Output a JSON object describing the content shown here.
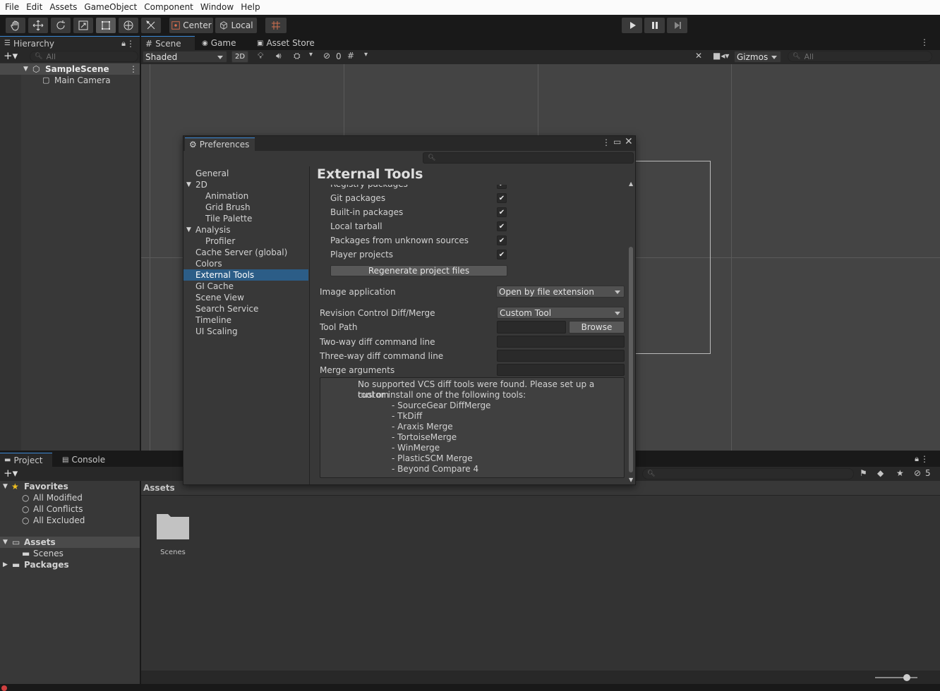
{
  "menubar": {
    "items": [
      "File",
      "Edit",
      "Assets",
      "GameObject",
      "Component",
      "Window",
      "Help"
    ]
  },
  "toolbar": {
    "tools": [
      "hand-icon",
      "move-icon",
      "rotate-icon",
      "scale-icon",
      "rect-icon",
      "transform-icon",
      "custom-tool-icon"
    ],
    "pivot_label": "Center",
    "space_label": "Local",
    "play_controls": [
      "play-icon",
      "pause-icon",
      "step-icon"
    ]
  },
  "hierarchy": {
    "tab_label": "Hierarchy",
    "search_placeholder": "All",
    "scene_name": "SampleScene",
    "objects": [
      "Main Camera"
    ]
  },
  "scene_view": {
    "tabs": [
      "Scene",
      "Game",
      "Asset Store"
    ],
    "shading_mode": "Shaded",
    "mode_2d_label": "2D",
    "hidden_count": "0",
    "gizmos_label": "Gizmos",
    "search_placeholder": "All"
  },
  "preferences": {
    "window_title": "Preferences",
    "sidebar": {
      "items": [
        {
          "label": "General",
          "indent": 0
        },
        {
          "label": "2D",
          "indent": 0,
          "foldout": true
        },
        {
          "label": "Animation",
          "indent": 1
        },
        {
          "label": "Grid Brush",
          "indent": 1
        },
        {
          "label": "Tile Palette",
          "indent": 1
        },
        {
          "label": "Analysis",
          "indent": 0,
          "foldout": true
        },
        {
          "label": "Profiler",
          "indent": 1
        },
        {
          "label": "Cache Server (global)",
          "indent": 0
        },
        {
          "label": "Colors",
          "indent": 0
        },
        {
          "label": "External Tools",
          "indent": 0,
          "selected": true
        },
        {
          "label": "GI Cache",
          "indent": 0
        },
        {
          "label": "Scene View",
          "indent": 0
        },
        {
          "label": "Search Service",
          "indent": 0
        },
        {
          "label": "Timeline",
          "indent": 0
        },
        {
          "label": "UI Scaling",
          "indent": 0
        }
      ]
    },
    "content": {
      "heading": "External Tools",
      "package_options": [
        {
          "label": "Registry packages",
          "checked": true
        },
        {
          "label": "Git packages",
          "checked": true
        },
        {
          "label": "Built-in packages",
          "checked": true
        },
        {
          "label": "Local tarball",
          "checked": true
        },
        {
          "label": "Packages from unknown sources",
          "checked": true
        },
        {
          "label": "Player projects",
          "checked": true
        }
      ],
      "regenerate_label": "Regenerate project files",
      "image_application_label": "Image application",
      "image_application_value": "Open by file extension",
      "revision_control_label": "Revision Control Diff/Merge",
      "revision_control_value": "Custom Tool",
      "tool_path_label": "Tool Path",
      "tool_path_value": "",
      "browse_label": "Browse",
      "two_way_label": "Two-way diff command line",
      "three_way_label": "Three-way diff command line",
      "merge_args_label": "Merge arguments",
      "help_text_1": "No supported VCS diff tools were found. Please set up a custom",
      "help_text_2": "tool or install one of the following tools:",
      "tool_list": [
        "- SourceGear DiffMerge",
        "- TkDiff",
        "- Araxis Merge",
        "- TortoiseMerge",
        "- WinMerge",
        "- PlasticSCM Merge",
        "- Beyond Compare 4"
      ]
    }
  },
  "project": {
    "tabs": [
      "Project",
      "Console"
    ],
    "favorites_label": "Favorites",
    "favorites": [
      "All Modified",
      "All Conflicts",
      "All Excluded"
    ],
    "assets_label": "Assets",
    "assets_children": [
      "Scenes"
    ],
    "packages_label": "Packages",
    "breadcrumb": "Assets",
    "grid_items": [
      "Scenes"
    ],
    "hidden_count": "5"
  },
  "colors": {
    "accent": "#3b8ad8",
    "selection": "#2c5d87",
    "error": "#d04040"
  }
}
